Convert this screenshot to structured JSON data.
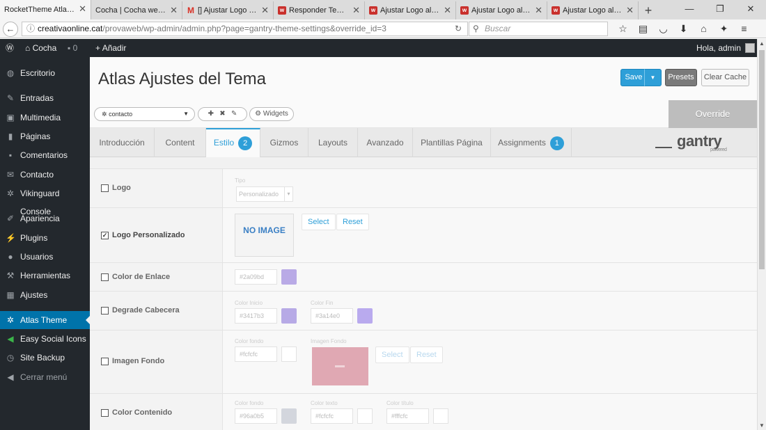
{
  "browser": {
    "tabs": [
      {
        "label": "RocketTheme Atlas The",
        "favicon": ""
      },
      {
        "label": "Cocha | Cocha web pro",
        "favicon": ""
      },
      {
        "label": "[] Ajustar Logo al A",
        "favicon": "M"
      },
      {
        "label": "Responder Tema: A",
        "favicon": "w"
      },
      {
        "label": "Ajustar Logo al Anc",
        "favicon": "w"
      },
      {
        "label": "Ajustar Logo al Anc",
        "favicon": "w"
      },
      {
        "label": "Ajustar Logo al Anc",
        "favicon": "w"
      }
    ],
    "url_domain": "creativaonline.cat",
    "url_path": "/provaweb/wp-admin/admin.php?page=gantry-theme-settings&override_id=3",
    "search_placeholder": "Buscar"
  },
  "adminbar": {
    "site": "Cocha",
    "comments": "0",
    "add": "Añadir",
    "greeting": "Hola, admin"
  },
  "sidebar": {
    "items": [
      {
        "label": "Escritorio",
        "icon": "dashboard-icon"
      },
      {
        "label": "Entradas",
        "icon": "pin-icon"
      },
      {
        "label": "Multimedia",
        "icon": "media-icon"
      },
      {
        "label": "Páginas",
        "icon": "page-icon"
      },
      {
        "label": "Comentarios",
        "icon": "comment-icon"
      },
      {
        "label": "Contacto",
        "icon": "mail-icon"
      },
      {
        "label": "Vikinguard Console",
        "icon": "gear-icon"
      },
      {
        "label": "Apariencia",
        "icon": "brush-icon"
      },
      {
        "label": "Plugins",
        "icon": "plugin-icon"
      },
      {
        "label": "Usuarios",
        "icon": "user-icon"
      },
      {
        "label": "Herramientas",
        "icon": "wrench-icon"
      },
      {
        "label": "Ajustes",
        "icon": "settings-icon"
      },
      {
        "label": "Atlas Theme",
        "icon": "gear-icon"
      },
      {
        "label": "Easy Social Icons",
        "icon": "share-icon"
      },
      {
        "label": "Site Backup",
        "icon": "clock-icon"
      },
      {
        "label": "Cerrar menú",
        "icon": "collapse-icon"
      }
    ]
  },
  "page": {
    "title": "Atlas Ajustes del Tema",
    "save": "Save",
    "presets": "Presets",
    "clear_cache": "Clear Cache",
    "override": "Override",
    "selector": "contacto",
    "widgets": "Widgets"
  },
  "tabs": [
    {
      "label": "Introducción"
    },
    {
      "label": "Content"
    },
    {
      "label": "Estilo",
      "badge": "2"
    },
    {
      "label": "Gizmos"
    },
    {
      "label": "Layouts"
    },
    {
      "label": "Avanzado"
    },
    {
      "label": "Plantillas Página"
    },
    {
      "label": "Assignments",
      "badge": "1"
    }
  ],
  "brand": {
    "name": "gantry",
    "tag": "powered"
  },
  "settings": {
    "logo": {
      "label": "Logo",
      "checked": false,
      "tipo_label": "Tipo",
      "tipo_value": "Personalizado"
    },
    "logo_custom": {
      "label": "Logo Personalizado",
      "checked": true,
      "noimg": "NO IMAGE",
      "select": "Select",
      "reset": "Reset"
    },
    "link_color": {
      "label": "Color de Enlace",
      "checked": false,
      "value": "#2a09bd",
      "swatch": "#b9aae6"
    },
    "header_gradient": {
      "label": "Degrade Cabecera",
      "checked": false,
      "start_label": "Color Inicio",
      "start_value": "#3417b3",
      "start_swatch": "#b7aae6",
      "end_label": "Color Fin",
      "end_value": "#3a14e0",
      "end_swatch": "#b9aaee"
    },
    "bg_image": {
      "label": "Imagen Fondo",
      "checked": false,
      "bg_label": "Color fondo",
      "bg_value": "#fcfcfc",
      "img_label": "Imagen Fondo",
      "select": "Select",
      "reset": "Reset"
    },
    "content_color": {
      "label": "Color Contenido",
      "checked": false,
      "bg_label": "Color fondo",
      "bg_value": "#96a0b5",
      "text_label": "Color texto",
      "text_value": "#fcfcfc",
      "title_label": "Color título",
      "title_value": "#fffcfc"
    }
  }
}
